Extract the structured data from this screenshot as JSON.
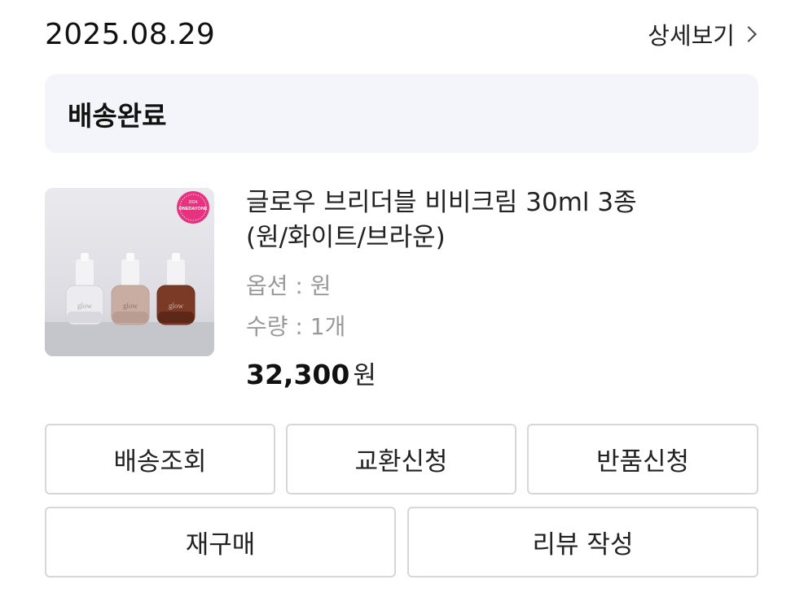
{
  "order": {
    "date": "2025.08.29",
    "detail_label": "상세보기",
    "status": "배송완료"
  },
  "product": {
    "name_line1": "글로우 브리더블 비비크림 30ml 3종",
    "name_line2": "(원/화이트/브라운)",
    "option": "옵션 : 원",
    "quantity": "수량 : 1개",
    "price": "32,300",
    "currency": "원",
    "badge_text": "ONEDAYONE",
    "bottle_label": "glow"
  },
  "actions": {
    "track_shipping": "배송조회",
    "exchange_request": "교환신청",
    "return_request": "반품신청",
    "reorder": "재구매",
    "write_review": "리뷰 작성"
  },
  "colors": {
    "status_bg": "#f4f5fa",
    "button_border": "#d7d7db",
    "meta_text": "#9a9a9a",
    "badge_pink": "#e8317f"
  }
}
